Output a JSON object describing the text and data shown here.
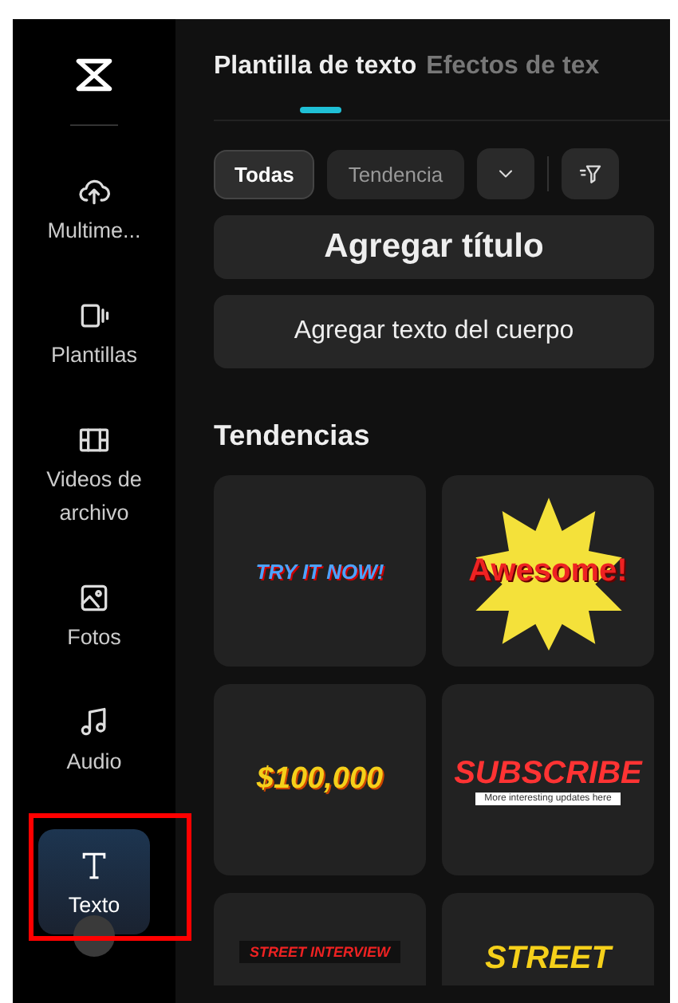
{
  "sidebar": {
    "items": [
      {
        "kind": "upload",
        "label": "Multime...",
        "selected": false
      },
      {
        "kind": "templates",
        "label": "Plantillas",
        "selected": false
      },
      {
        "kind": "film",
        "label": "Videos de archivo",
        "selected": false
      },
      {
        "kind": "photo",
        "label": "Fotos",
        "selected": false
      },
      {
        "kind": "audio",
        "label": "Audio",
        "selected": false
      },
      {
        "kind": "text",
        "label": "Texto",
        "selected": true
      }
    ]
  },
  "tabs": [
    {
      "label": "Plantilla de texto",
      "selected": true
    },
    {
      "label": "Efectos de tex",
      "selected": false
    }
  ],
  "filters": [
    {
      "label": "Todas",
      "selected": true
    },
    {
      "label": "Tendencia",
      "selected": false
    }
  ],
  "add_title_button": "Agregar título",
  "add_body_button": "Agregar texto del cuerpo",
  "section_title": "Tendencias",
  "templates": [
    {
      "kind": "try",
      "texts": [
        "TRY IT NOW!"
      ]
    },
    {
      "kind": "awesome",
      "texts": [
        "Awesome!"
      ]
    },
    {
      "kind": "money",
      "texts": [
        "$100,000"
      ]
    },
    {
      "kind": "subscribe",
      "texts": [
        "SUBSCRIBE",
        "More interesting updates here"
      ]
    },
    {
      "kind": "banner",
      "texts": [
        "STREET INTERVIEW"
      ]
    },
    {
      "kind": "street",
      "texts": [
        "STREET"
      ]
    }
  ]
}
